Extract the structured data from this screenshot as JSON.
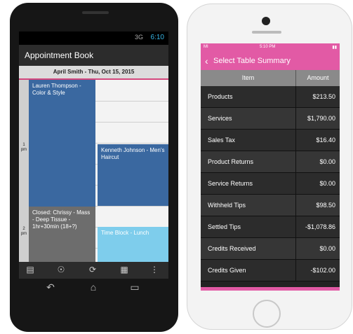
{
  "android": {
    "status_time": "6:10",
    "status_signal": "3G",
    "title": "Appointment Book",
    "date_header": "April Smith - Thu, Oct 15, 2015",
    "hours": [
      {
        "num": "1",
        "ampm": "pm"
      },
      {
        "num": "2",
        "ampm": "pm"
      }
    ],
    "appointments": {
      "a1": "Lauren Thompson - Color & Style",
      "a2": "Kenneth Johnson - Men's Haircut",
      "a3": "Closed: Chrissy - Mass - Deep Tissue - 1hr+30min (18+?)",
      "a4": "Time Block -  Lunch"
    },
    "toolbar_icons": [
      "calendar-add-icon",
      "person-add-icon",
      "refresh-icon",
      "calendar-icon",
      "overflow-menu-icon"
    ],
    "nav_icons": [
      "back-icon",
      "home-icon",
      "recents-icon"
    ],
    "colors": {
      "accent": "#d4477d",
      "appt_blue": "#3a68a0",
      "appt_gray": "#6d6d6d",
      "appt_light": "#7ecdec"
    }
  },
  "iphone": {
    "status_left": "MI",
    "status_time": "5:10 PM",
    "nav_back_label": "Select Table",
    "nav_title": "Summary",
    "table_headers": {
      "item": "Item",
      "amount": "Amount"
    },
    "rows": [
      {
        "label": "Products",
        "amount": "$213.50"
      },
      {
        "label": "Services",
        "amount": "$1,790.00"
      },
      {
        "label": "Sales Tax",
        "amount": "$16.40"
      },
      {
        "label": "Product Returns",
        "amount": "$0.00"
      },
      {
        "label": "Service Returns",
        "amount": "$0.00"
      },
      {
        "label": "Withheld Tips",
        "amount": "$98.50"
      },
      {
        "label": "Settled Tips",
        "amount": "-$1,078.86"
      },
      {
        "label": "Credits Received",
        "amount": "$0.00"
      },
      {
        "label": "Credits Given",
        "amount": "-$102.00"
      }
    ],
    "colors": {
      "accent": "#e25aa5"
    }
  }
}
